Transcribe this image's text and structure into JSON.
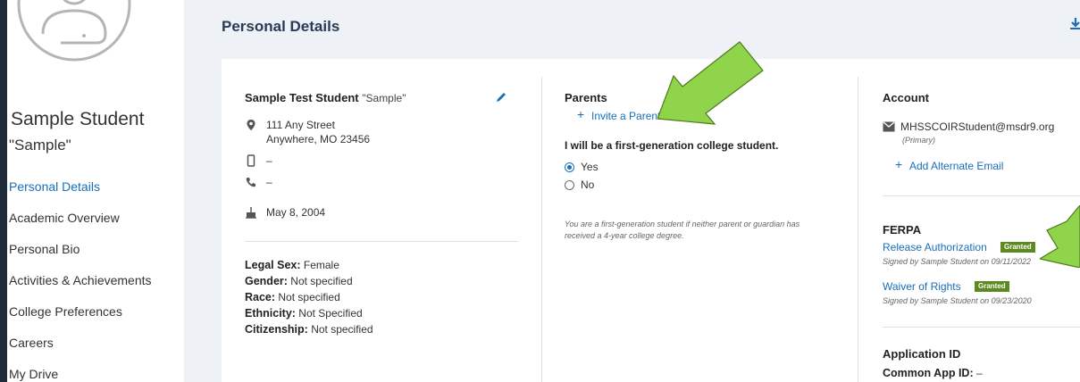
{
  "sidebar": {
    "student_name": "Sample Student",
    "student_nickname": "\"Sample\"",
    "nav": [
      {
        "label": "Personal Details",
        "active": true
      },
      {
        "label": "Academic Overview",
        "active": false
      },
      {
        "label": "Personal Bio",
        "active": false
      },
      {
        "label": "Activities & Achievements",
        "active": false
      },
      {
        "label": "College Preferences",
        "active": false
      },
      {
        "label": "Careers",
        "active": false
      },
      {
        "label": "My Drive",
        "active": false
      }
    ]
  },
  "header": {
    "title": "Personal Details"
  },
  "profile": {
    "name": "Sample Test Student",
    "nickname": "\"Sample\"",
    "address_line1": "111 Any Street",
    "address_line2": "Anywhere, MO 23456",
    "mobile": "–",
    "phone": "–",
    "birthday": "May 8, 2004",
    "legal_sex_label": "Legal Sex:",
    "legal_sex_value": "Female",
    "gender_label": "Gender:",
    "gender_value": "Not specified",
    "race_label": "Race:",
    "race_value": "Not specified",
    "ethnicity_label": "Ethnicity:",
    "ethnicity_value": "Not Specified",
    "citizenship_label": "Citizenship:",
    "citizenship_value": "Not specified"
  },
  "parents": {
    "title": "Parents",
    "invite_label": "Invite a Parent",
    "question": "I will be a first-generation college student.",
    "option_yes": "Yes",
    "option_no": "No",
    "selected": "Yes",
    "note": "You are a first-generation student if neither parent or guardian has received a 4-year college degree."
  },
  "account": {
    "title": "Account",
    "email": "MHSSCOIRStudent@msdr9.org",
    "email_tag": "(Primary)",
    "add_email_label": "Add Alternate Email"
  },
  "ferpa": {
    "title": "FERPA",
    "items": [
      {
        "label": "Release Authorization",
        "status": "Granted",
        "signed": "Signed by Sample Student on 09/11/2022"
      },
      {
        "label": "Waiver of Rights",
        "status": "Granted",
        "signed": "Signed by Sample Student on 09/23/2020"
      }
    ]
  },
  "application": {
    "title": "Application ID",
    "common_app_label": "Common App ID:",
    "common_app_value": "–"
  },
  "colors": {
    "accent": "#1a6eb8",
    "badge": "#5c8a1e",
    "arrow": "#8fd44a",
    "frame": "#1f2a3a"
  }
}
